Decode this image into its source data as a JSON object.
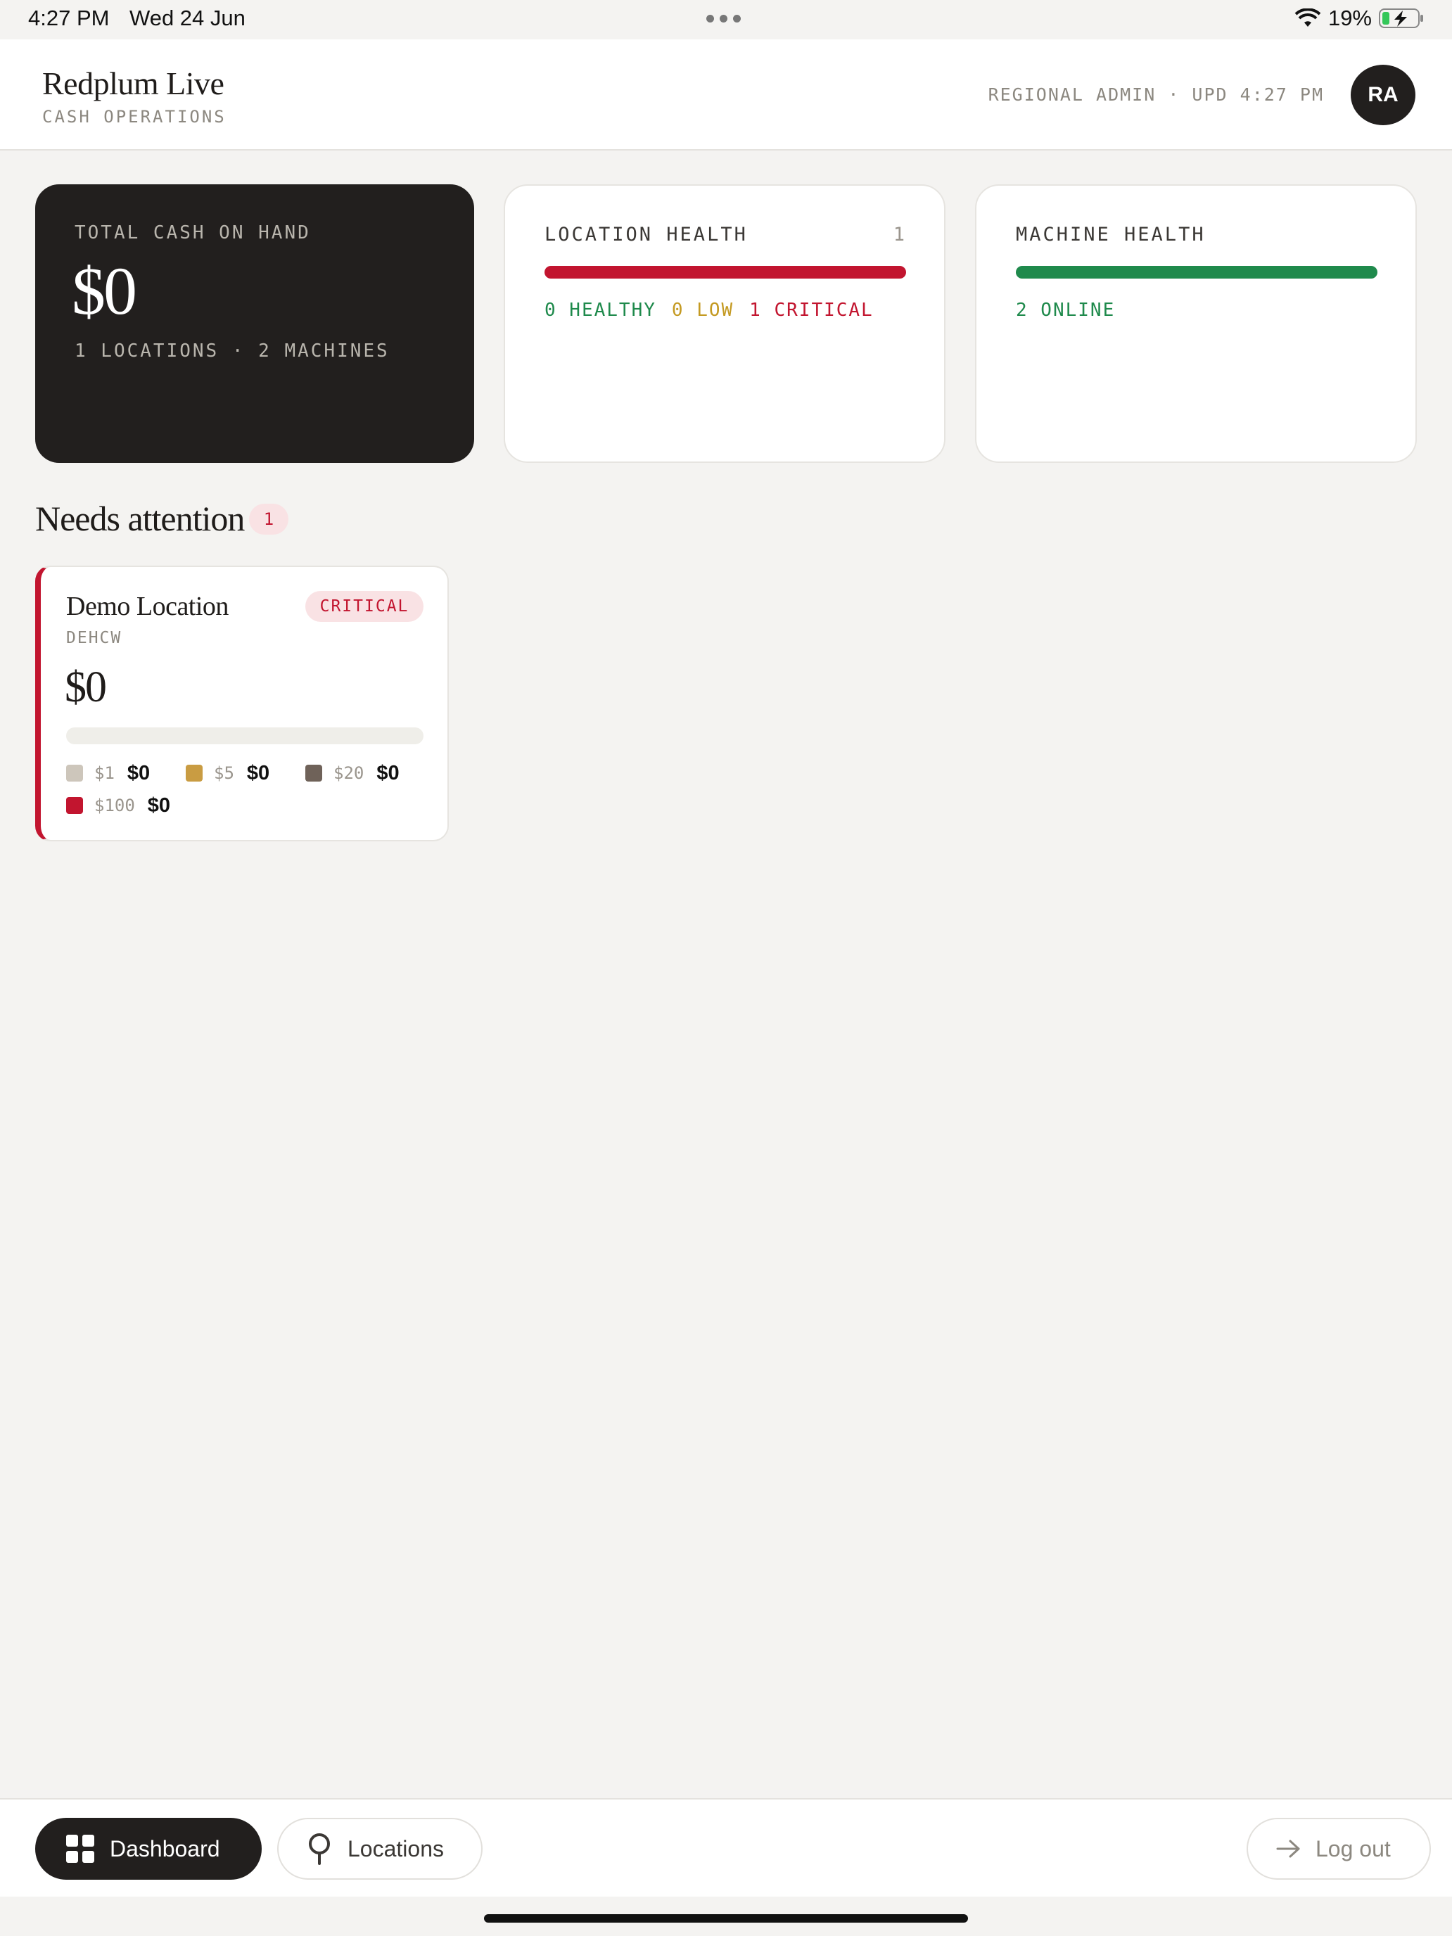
{
  "status_bar": {
    "time": "4:27 PM",
    "date": "Wed 24 Jun",
    "battery": "19%"
  },
  "header": {
    "title": "Redplum Live",
    "subtitle": "CASH OPERATIONS",
    "meta": "REGIONAL ADMIN · UPD 4:27 PM",
    "avatar_initials": "RA"
  },
  "summary": {
    "cash": {
      "label": "TOTAL CASH ON HAND",
      "value": "$0",
      "meta": "1 LOCATIONS · 2 MACHINES"
    },
    "location_health": {
      "label": "LOCATION HEALTH",
      "count": "1",
      "healthy": "0 HEALTHY",
      "low": "0 LOW",
      "critical": "1 CRITICAL"
    },
    "machine_health": {
      "label": "MACHINE HEALTH",
      "online": "2 ONLINE"
    }
  },
  "attention": {
    "title": "Needs attention",
    "count": "1",
    "locations": [
      {
        "name": "Demo Location",
        "code": "DEHCW",
        "status": "CRITICAL",
        "value": "$0",
        "denominations": [
          {
            "label": "$1",
            "value": "$0",
            "color": "#cdc6bb"
          },
          {
            "label": "$5",
            "value": "$0",
            "color": "#c99c42"
          },
          {
            "label": "$20",
            "value": "$0",
            "color": "#6f6259"
          },
          {
            "label": "$100",
            "value": "$0",
            "color": "#c2152f"
          }
        ]
      }
    ]
  },
  "nav": {
    "dashboard": "Dashboard",
    "locations": "Locations",
    "logout": "Log out"
  },
  "colors": {
    "accent_dark": "#221f1e",
    "critical": "#c2152f",
    "healthy": "#1f8a4c",
    "low": "#c49a22"
  }
}
